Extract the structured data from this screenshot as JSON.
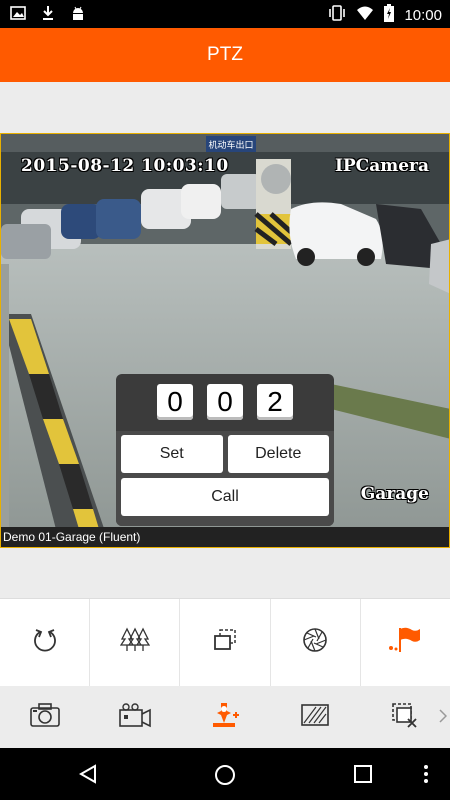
{
  "status_bar": {
    "time": "10:00",
    "left_icons": [
      "image-icon",
      "download-icon",
      "android-icon"
    ],
    "right_icons": [
      "vibrate-icon",
      "wifi-icon",
      "battery-icon"
    ]
  },
  "app_bar": {
    "title": "PTZ"
  },
  "video": {
    "timestamp": "2015-08-12 10:03:10",
    "camera_brand": "IPCamera",
    "location_label": "Garage",
    "sign_text": "机动车出口",
    "caption": "Demo 01-Garage (Fluent)"
  },
  "preset_panel": {
    "digits": [
      "0",
      "0",
      "2"
    ],
    "set_label": "Set",
    "delete_label": "Delete",
    "call_label": "Call"
  },
  "ptz_toolbar": {
    "items": [
      {
        "icon": "rotate-icon"
      },
      {
        "icon": "trees-icon"
      },
      {
        "icon": "layers-icon"
      },
      {
        "icon": "iris-icon"
      },
      {
        "icon": "flag-icon",
        "active": true
      }
    ]
  },
  "bottom_toolbar": {
    "items": [
      {
        "icon": "camera-icon"
      },
      {
        "icon": "video-record-icon"
      },
      {
        "icon": "ptz-icon",
        "active": true
      },
      {
        "icon": "image-quality-icon"
      },
      {
        "icon": "close-window-icon"
      }
    ]
  },
  "colors": {
    "accent": "#ff5a00",
    "status_bar": "#000000",
    "video_border": "#e8b000"
  }
}
